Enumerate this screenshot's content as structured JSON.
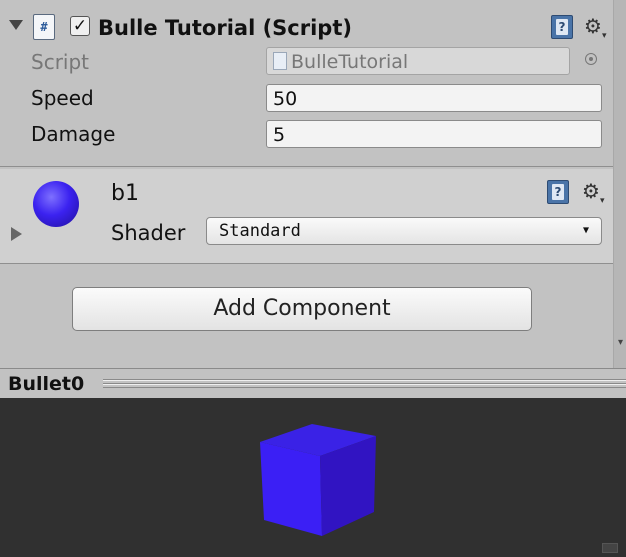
{
  "component": {
    "title": "Bulle Tutorial (Script)",
    "enabled": true,
    "icon": "csharp-script-icon",
    "help_icon": "help-book-icon",
    "settings_icon": "gear-icon"
  },
  "properties": {
    "script_label": "Script",
    "script_value": "BulleTutorial",
    "speed_label": "Speed",
    "speed_value": "50",
    "damage_label": "Damage",
    "damage_value": "5"
  },
  "material": {
    "name": "b1",
    "shader_label": "Shader",
    "shader_value": "Standard",
    "sphere_color": "#3b22f0"
  },
  "add_component_label": "Add Component",
  "preview": {
    "title": "Bullet0",
    "cube_color": "#3a1ff2"
  }
}
